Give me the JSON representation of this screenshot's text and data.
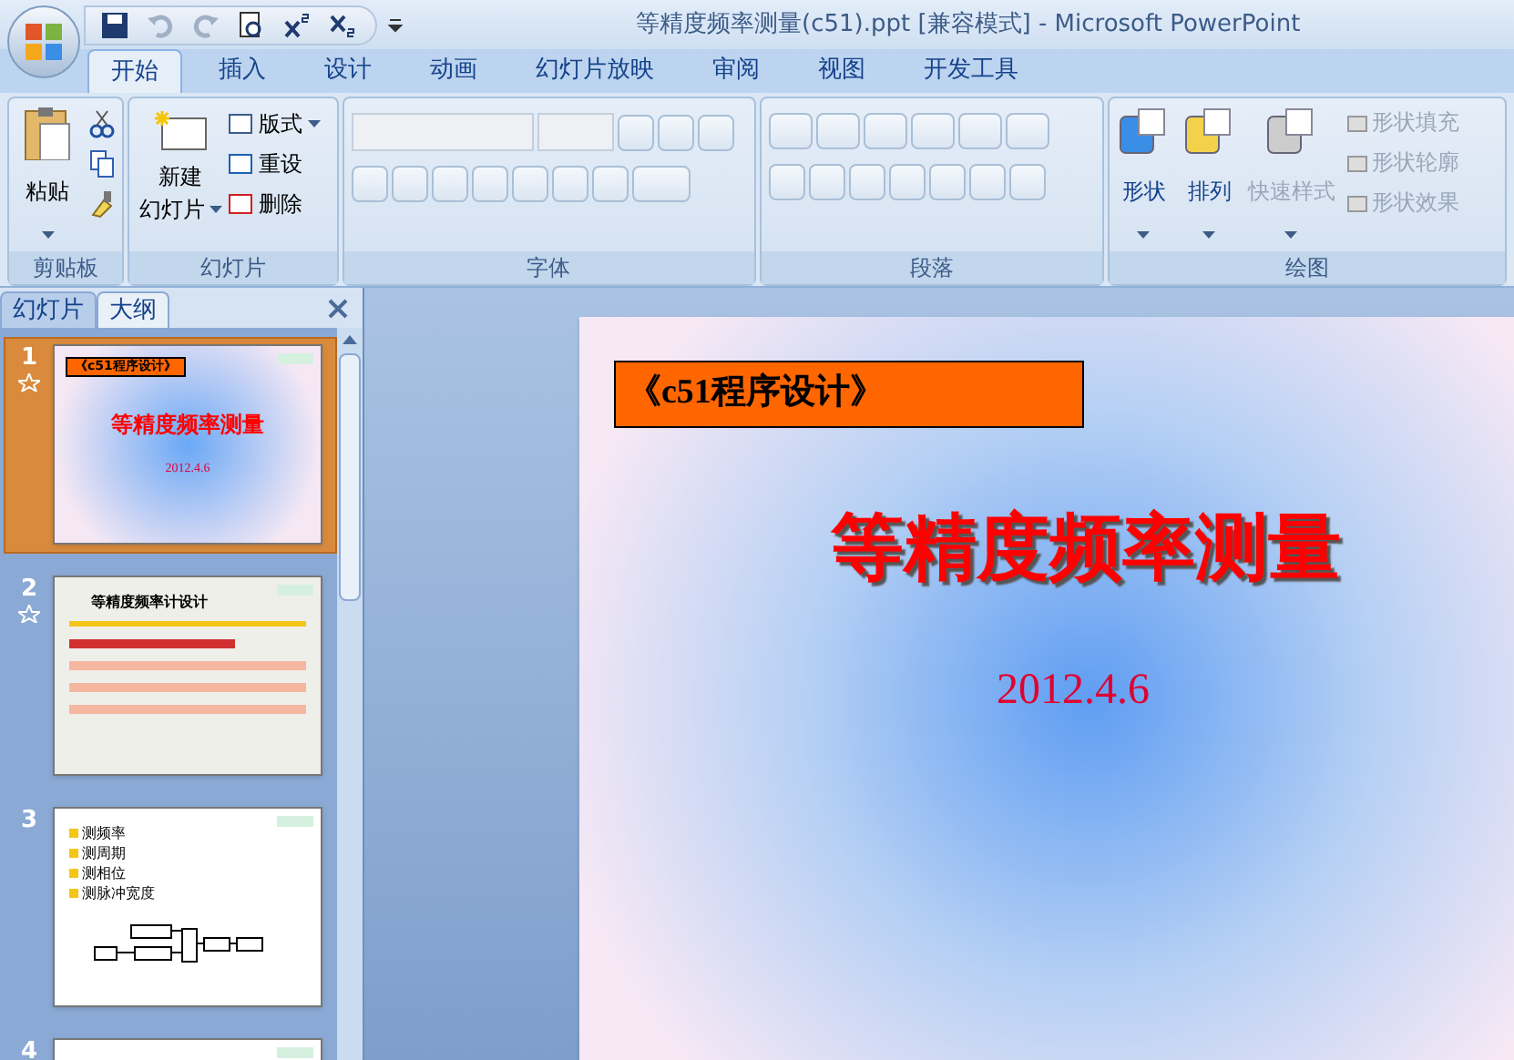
{
  "window": {
    "title": "等精度频率测量(c51).ppt [兼容模式] - Microsoft PowerPoint"
  },
  "quick_access": [
    {
      "kind": "save",
      "disabled": false
    },
    {
      "kind": "undo",
      "disabled": true
    },
    {
      "kind": "redo",
      "disabled": true
    },
    {
      "kind": "preview",
      "disabled": false
    },
    {
      "kind": "superscript",
      "disabled": false
    },
    {
      "kind": "subscript",
      "disabled": false
    }
  ],
  "tabs": [
    {
      "label": "开始",
      "selected": true
    },
    {
      "label": "插入",
      "selected": false
    },
    {
      "label": "设计",
      "selected": false
    },
    {
      "label": "动画",
      "selected": false
    },
    {
      "label": "幻灯片放映",
      "selected": false
    },
    {
      "label": "审阅",
      "selected": false
    },
    {
      "label": "视图",
      "selected": false
    },
    {
      "label": "开发工具",
      "selected": false
    }
  ],
  "ribbon": {
    "clipboard": {
      "name": "剪贴板",
      "paste": "粘贴"
    },
    "slides": {
      "name": "幻灯片",
      "new_slide": [
        "新建",
        "幻灯片"
      ],
      "layout": "版式",
      "reset": "重设",
      "delete": "删除"
    },
    "font": {
      "name": "字体"
    },
    "paragraph": {
      "name": "段落"
    },
    "drawing": {
      "name": "绘图",
      "shape": "形状",
      "arrange": "排列",
      "quick_styles": "快速样式",
      "fill": "形状填充",
      "outline": "形状轮廓",
      "effects": "形状效果"
    }
  },
  "pane_tabs": [
    {
      "label": "幻灯片",
      "selected": true
    },
    {
      "label": "大纲",
      "selected": false
    }
  ],
  "thumbnails": [
    {
      "number": "1",
      "selected": true,
      "has_animation": true,
      "kind": "title",
      "tag": "《c51程序设计》",
      "title": "等精度频率测量",
      "date": "2012.4.6"
    },
    {
      "number": "2",
      "selected": false,
      "has_animation": true,
      "kind": "text",
      "title": "等精度频率计设计"
    },
    {
      "number": "3",
      "selected": false,
      "has_animation": false,
      "kind": "bullets",
      "bullets": [
        "测频率",
        "测周期",
        "测相位",
        "测脉冲宽度"
      ]
    },
    {
      "number": "4",
      "selected": false,
      "has_animation": false,
      "kind": "blank"
    }
  ],
  "slide": {
    "tag": "《c51程序设计》",
    "title": "等精度频率测量",
    "date": "2012.4.6"
  }
}
